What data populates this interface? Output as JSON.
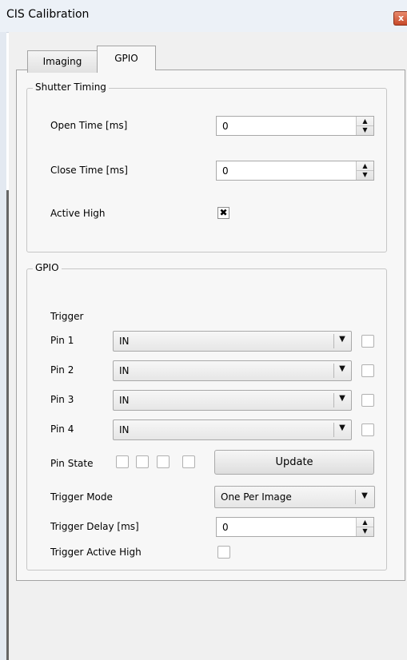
{
  "window": {
    "title": "CIS Calibration",
    "close_glyph": "x"
  },
  "tabs": [
    {
      "label": "Imaging"
    },
    {
      "label": "GPIO"
    }
  ],
  "shutter": {
    "group_title": "Shutter Timing",
    "open_time_label": "Open Time [ms]",
    "open_time_value": "0",
    "close_time_label": "Close Time [ms]",
    "close_time_value": "0",
    "active_high_label": "Active High",
    "active_high_checked": true,
    "check_glyph": "✖"
  },
  "gpio": {
    "group_title": "GPIO",
    "trigger_header": "Trigger",
    "pins": [
      {
        "label": "Pin 1",
        "value": "IN"
      },
      {
        "label": "Pin 2",
        "value": "IN"
      },
      {
        "label": "Pin 3",
        "value": "IN"
      },
      {
        "label": "Pin 4",
        "value": "IN"
      }
    ],
    "pin_state_label": "Pin State",
    "update_button": "Update",
    "trigger_mode_label": "Trigger Mode",
    "trigger_mode_value": "One Per Image",
    "trigger_delay_label": "Trigger Delay [ms]",
    "trigger_delay_value": "0",
    "trigger_active_high_label": "Trigger Active High"
  },
  "icons": {
    "spin_up": "▲",
    "spin_down": "▼",
    "dropdown": "▼"
  }
}
